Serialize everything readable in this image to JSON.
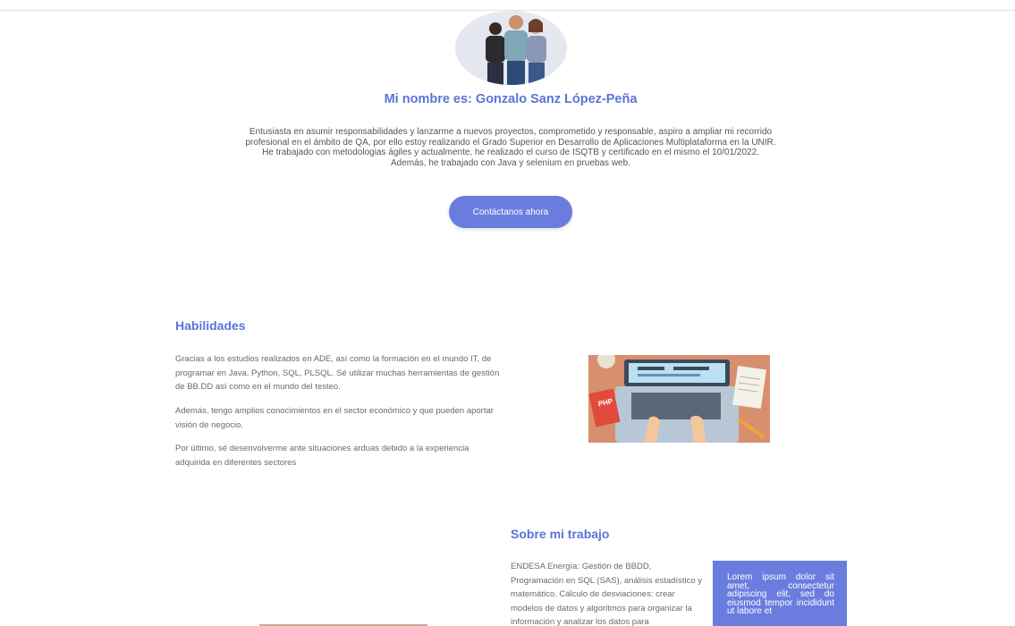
{
  "profile": {
    "title": "Mi nombre es: Gonzalo Sanz López-Peña",
    "intro_lines": [
      "Entusiasta en asumir responsabilidades y lanzarme a nuevos proyectos, comprometido y responsable, aspiro a ampliar mi recorrido profesional en el ámbito de QA, por ello estoy realizando el Grado Superior en Desarrollo de Aplicaciones Multiplataforma en la UNIR.",
      "He trabajado con metodologias ágiles y actualmente, he realizado el curso de ISQTB y certificado en el mismo el 10/01/2022.",
      "Además, he trabajado con Java y selenium en pruebas web."
    ],
    "cta_label": "Contáctanos ahora"
  },
  "skills": {
    "title": "Habilidades",
    "paragraphs": [
      "Gracias a los estudios realizados en ADE, así como la formación en el mundo IT, de programar en Java, Python, SQL, PLSQL. Sé utilizar muchas herramientas de gestión de BB.DD así como en el mundo del testeo.",
      "Además, tengo amplios conocimientos en el sector económico y que pueden aportar visión de negocio.",
      "Por último, sé desenvolverme ante situaciones arduas debido a la experiencia adquirida en diferentes sectores"
    ],
    "image_sticker_text": "PHP"
  },
  "work": {
    "title": "Sobre mi trabajo",
    "paragraph": "ENDESA Energía: Gestión de BBDD, Programación en SQL (SAS), análisis estadístico y matemático. Cálculo de desviaciones: crear modelos de datos y algoritmos para organizar la información y analizar los datos para",
    "lorem": "Lorem ipsum dolor sit amet, consectetur adipiscing elit, sed do eiusmod tempor incididunt ut labore et"
  },
  "colors": {
    "accent": "#5b74d6",
    "button": "#6a7ddf"
  }
}
